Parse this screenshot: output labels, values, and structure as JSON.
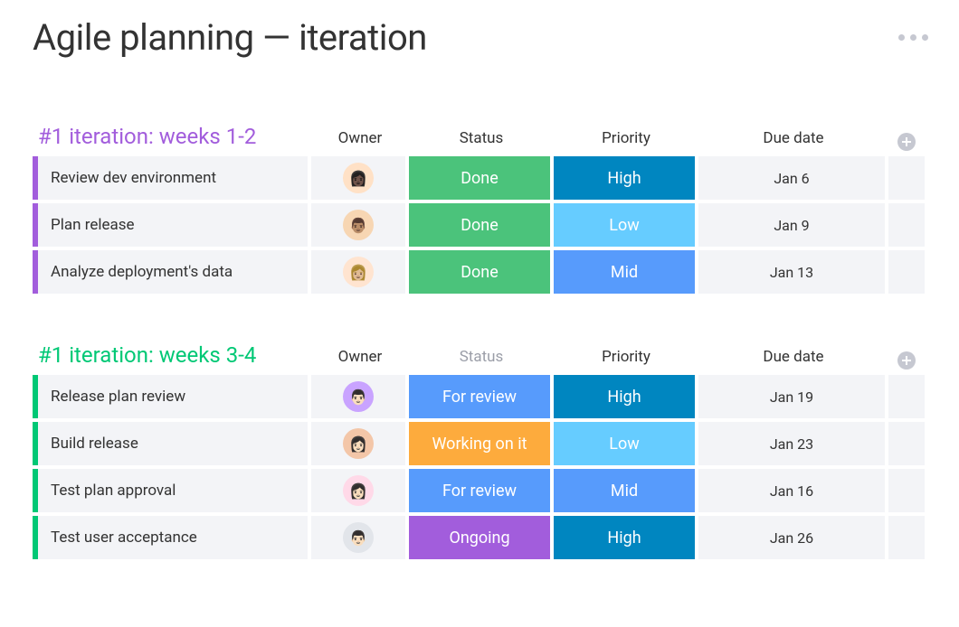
{
  "title": "Agile planning — iteration",
  "columns": {
    "owner": "Owner",
    "status": "Status",
    "priority": "Priority",
    "due": "Due date"
  },
  "status_colors": {
    "Done": "bg-done",
    "For review": "bg-review",
    "Working on it": "bg-working",
    "Ongoing": "bg-ongoing"
  },
  "priority_colors": {
    "High": "bg-high",
    "Mid": "bg-mid",
    "Low": "bg-low"
  },
  "groups": [
    {
      "id": "g1",
      "title": "#1 iteration: weeks 1-2",
      "title_color_class": "c-purple",
      "stripe_class": "stripe-purple",
      "status_header_muted": false,
      "rows": [
        {
          "task": "Review dev environment",
          "owner_glyph": "👩🏿",
          "owner_av": "av-a",
          "status": "Done",
          "priority": "High",
          "due": "Jan 6"
        },
        {
          "task": "Plan release",
          "owner_glyph": "👨🏽",
          "owner_av": "av-b",
          "status": "Done",
          "priority": "Low",
          "due": "Jan 9"
        },
        {
          "task": "Analyze deployment's data",
          "owner_glyph": "👩🏼",
          "owner_av": "av-c",
          "status": "Done",
          "priority": "Mid",
          "due": "Jan 13"
        }
      ]
    },
    {
      "id": "g2",
      "title": "#1 iteration: weeks 3-4",
      "title_color_class": "c-green",
      "stripe_class": "stripe-green",
      "status_header_muted": true,
      "rows": [
        {
          "task": "Release plan review",
          "owner_glyph": "👨🏻",
          "owner_av": "av-d",
          "status": "For review",
          "priority": "High",
          "due": "Jan 19"
        },
        {
          "task": "Build release",
          "owner_glyph": "👩🏻",
          "owner_av": "av-e",
          "status": "Working on it",
          "priority": "Low",
          "due": "Jan 23"
        },
        {
          "task": "Test plan approval",
          "owner_glyph": "👩🏻",
          "owner_av": "av-f",
          "status": "For review",
          "priority": "Mid",
          "due": "Jan 16"
        },
        {
          "task": "Test user acceptance",
          "owner_glyph": "👨🏻",
          "owner_av": "av-g",
          "status": "Ongoing",
          "priority": "High",
          "due": "Jan 26"
        }
      ]
    }
  ]
}
